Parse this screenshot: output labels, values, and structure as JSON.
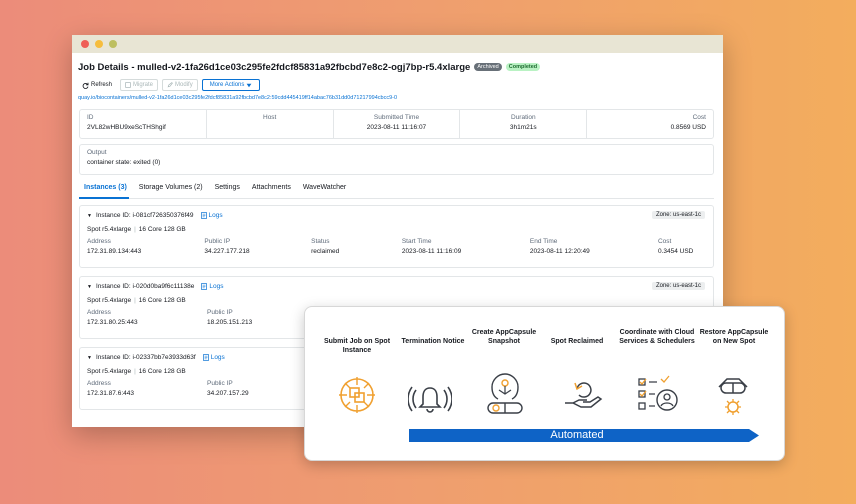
{
  "window": {
    "title": "Job Details - mulled-v2-1fa26d1ce03c295fe2fdcf85831a92fbcbd7e8c2-ogj7bp-r5.4xlarge",
    "badges": {
      "archived": "Archived",
      "completed": "Completed"
    },
    "toolbar": {
      "refresh": "Refresh",
      "migrate": "Migrate",
      "modify": "Modify",
      "more_actions": "More Actions"
    },
    "image_link": "quay.io/biocontainers/mulled-v2-1fa26d1ce03c295fe2fdcf85831a92fbcbd7e8c2:59cdd445419ff14abac76b31dd0d71217994cbcc9-0",
    "summary": {
      "id_label": "ID",
      "id_value": "2VL82wHBU9xeScTHShgif",
      "host_label": "Host",
      "host_value": "",
      "submitted_label": "Submitted Time",
      "submitted_value": "2023-08-11 11:16:07",
      "duration_label": "Duration",
      "duration_value": "3h1m21s",
      "cost_label": "Cost",
      "cost_value": "0.8569 USD"
    },
    "output": {
      "label": "Output",
      "value": "container state: exited (0)"
    },
    "tabs": [
      "Instances (3)",
      "Storage Volumes (2)",
      "Settings",
      "Attachments",
      "WaveWatcher"
    ],
    "instances": [
      {
        "id": "Instance ID: i-081cf726350376f49",
        "logs": "Logs",
        "zone": "Zone: us-east-1c",
        "spec_type": "Spot r5.4xlarge",
        "spec_cores": "16 Core 128 GB",
        "address_label": "Address",
        "address": "172.31.89.134:443",
        "public_ip_label": "Public IP",
        "public_ip": "34.227.177.218",
        "status_label": "Status",
        "status": "reclaimed",
        "start_label": "Start Time",
        "start": "2023-08-11 11:16:09",
        "end_label": "End Time",
        "end": "2023-08-11 12:20:49",
        "cost_label": "Cost",
        "cost": "0.3454 USD"
      },
      {
        "id": "Instance ID: i-020d0ba9f6c11138e",
        "logs": "Logs",
        "zone": "Zone: us-east-1c",
        "spec_type": "Spot r5.4xlarge",
        "spec_cores": "16 Core 128 GB",
        "address_label": "Address",
        "address": "172.31.80.25:443",
        "public_ip_label": "Public IP",
        "public_ip": "18.205.151.213"
      },
      {
        "id": "Instance ID: i-02337bb7e3933d63f",
        "logs": "Logs",
        "spec_type": "Spot r5.4xlarge",
        "spec_cores": "16 Core 128 GB",
        "address_label": "Address",
        "address": "172.31.87.6:443",
        "public_ip_label": "Public IP",
        "public_ip": "34.207.157.29"
      }
    ]
  },
  "workflow": {
    "steps": [
      {
        "label": "Submit Job on Spot Instance",
        "icon": "chip-target-icon"
      },
      {
        "label": "Termination Notice",
        "icon": "bell-alert-icon"
      },
      {
        "label": "Create AppCapsule Snapshot",
        "icon": "head-capsule-icon"
      },
      {
        "label": "Spot Reclaimed",
        "icon": "hand-reclaim-icon"
      },
      {
        "label": "Coordinate with Cloud Services & Schedulers",
        "icon": "checklist-user-icon"
      },
      {
        "label": "Restore AppCapsule on New Spot",
        "icon": "capsule-restore-icon"
      }
    ],
    "automated_label": "Automated",
    "colors": {
      "accent_orange": "#f0a030",
      "arrow_blue": "#0e63c6",
      "icon_dark": "#3a3f47"
    }
  }
}
